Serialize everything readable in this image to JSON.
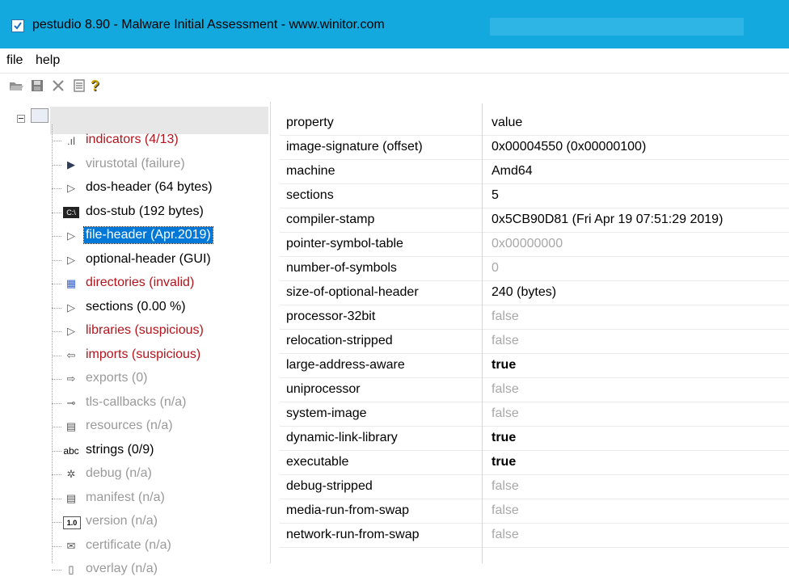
{
  "window": {
    "title": "pestudio 8.90 - Malware Initial Assessment - www.winitor.com"
  },
  "menu": {
    "file": "file",
    "help": "help"
  },
  "toolbar": {
    "icons": [
      "open-icon",
      "save-icon",
      "close-icon",
      "list-icon",
      "help-icon"
    ],
    "help_glyph": "?"
  },
  "tree": {
    "items": [
      {
        "name": "indicators",
        "label": "indicators (4/13)",
        "style": "red",
        "icon": "chart-icon",
        "glyph": ".ıl"
      },
      {
        "name": "virustotal",
        "label": "virustotal (failure)",
        "style": "grey",
        "icon": "virustotal-icon",
        "glyph": "▶"
      },
      {
        "name": "dos-header",
        "label": "dos-header (64 bytes)",
        "style": "black",
        "icon": "arrow-icon",
        "glyph": "▷"
      },
      {
        "name": "dos-stub",
        "label": "dos-stub (192 bytes)",
        "style": "black",
        "icon": "console-icon",
        "glyph": "C:\\"
      },
      {
        "name": "file-header",
        "label": "file-header (Apr.2019)",
        "style": "selected",
        "icon": "arrow-icon",
        "glyph": "▷"
      },
      {
        "name": "optional-header",
        "label": "optional-header (GUI)",
        "style": "black",
        "icon": "arrow-icon",
        "glyph": "▷"
      },
      {
        "name": "directories",
        "label": "directories (invalid)",
        "style": "red",
        "icon": "directories-icon",
        "glyph": "▦"
      },
      {
        "name": "sections",
        "label": "sections (0.00 %)",
        "style": "black",
        "icon": "arrow-icon",
        "glyph": "▷"
      },
      {
        "name": "libraries",
        "label": "libraries (suspicious)",
        "style": "red",
        "icon": "arrow-icon",
        "glyph": "▷"
      },
      {
        "name": "imports",
        "label": "imports (suspicious)",
        "style": "red",
        "icon": "imports-icon",
        "glyph": "⇦"
      },
      {
        "name": "exports",
        "label": "exports (0)",
        "style": "grey",
        "icon": "exports-icon",
        "glyph": "⇨"
      },
      {
        "name": "tls-callbacks",
        "label": "tls-callbacks (n/a)",
        "style": "grey",
        "icon": "key-icon",
        "glyph": "⊸"
      },
      {
        "name": "resources",
        "label": "resources (n/a)",
        "style": "grey",
        "icon": "resources-icon",
        "glyph": "▤"
      },
      {
        "name": "strings",
        "label": "strings (0/9)",
        "style": "black",
        "icon": "abc-icon",
        "glyph": "abc"
      },
      {
        "name": "debug",
        "label": "debug (n/a)",
        "style": "grey",
        "icon": "bug-icon",
        "glyph": "✲"
      },
      {
        "name": "manifest",
        "label": "manifest (n/a)",
        "style": "grey",
        "icon": "manifest-icon",
        "glyph": "▤"
      },
      {
        "name": "version",
        "label": "version (n/a)",
        "style": "grey",
        "icon": "version-icon",
        "glyph": "1.0"
      },
      {
        "name": "certificate",
        "label": "certificate (n/a)",
        "style": "grey",
        "icon": "certificate-icon",
        "glyph": "✉"
      },
      {
        "name": "overlay",
        "label": "overlay (n/a)",
        "style": "grey",
        "icon": "overlay-icon",
        "glyph": "▯"
      }
    ]
  },
  "grid": {
    "headers": {
      "property": "property",
      "value": "value"
    },
    "rows": [
      {
        "property": "image-signature (offset)",
        "value": "0x00004550 (0x00000100)",
        "style": "normal"
      },
      {
        "property": "machine",
        "value": "Amd64",
        "style": "normal"
      },
      {
        "property": "sections",
        "value": "5",
        "style": "normal"
      },
      {
        "property": "compiler-stamp",
        "value": "0x5CB90D81 (Fri Apr 19 07:51:29 2019)",
        "style": "normal"
      },
      {
        "property": "pointer-symbol-table",
        "value": "0x00000000",
        "style": "dim"
      },
      {
        "property": "number-of-symbols",
        "value": "0",
        "style": "dim"
      },
      {
        "property": "size-of-optional-header",
        "value": "240 (bytes)",
        "style": "normal"
      },
      {
        "property": "processor-32bit",
        "value": "false",
        "style": "dim"
      },
      {
        "property": "relocation-stripped",
        "value": "false",
        "style": "dim"
      },
      {
        "property": "large-address-aware",
        "value": "true",
        "style": "bold"
      },
      {
        "property": "uniprocessor",
        "value": "false",
        "style": "dim"
      },
      {
        "property": "system-image",
        "value": "false",
        "style": "dim"
      },
      {
        "property": "dynamic-link-library",
        "value": "true",
        "style": "bold"
      },
      {
        "property": "executable",
        "value": "true",
        "style": "bold"
      },
      {
        "property": "debug-stripped",
        "value": "false",
        "style": "dim"
      },
      {
        "property": "media-run-from-swap",
        "value": "false",
        "style": "dim"
      },
      {
        "property": "network-run-from-swap",
        "value": "false",
        "style": "dim"
      }
    ]
  },
  "colors": {
    "titlebar": "#13a9df",
    "selection": "#0078d7",
    "warning": "#b3141b",
    "disabled": "#9a9a9a"
  }
}
